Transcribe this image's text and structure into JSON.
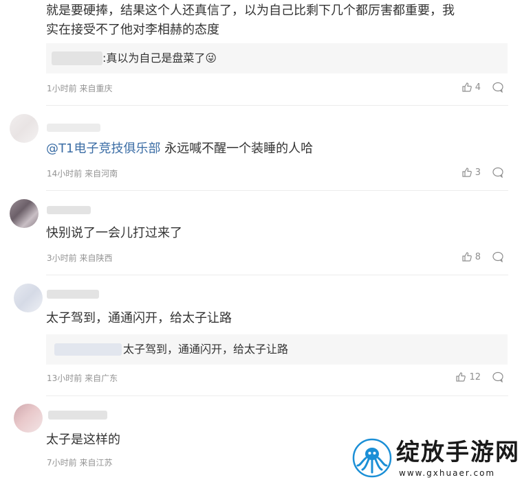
{
  "comments": [
    {
      "text_lines": [
        "就是要硬捧，结果这个人还真信了，以为自己比剩下几个都厉害都重要，我",
        "实在接受不了他对李相赫的态度"
      ],
      "reply": ":真以为自己是盘菜了😜",
      "meta": "1小时前 来自重庆",
      "likes": "4"
    },
    {
      "mention": "@T1电子竞技俱乐部",
      "text": " 永远喊不醒一个装睡的人哈",
      "meta": "14小时前 来自河南",
      "likes": "3"
    },
    {
      "text": "快别说了一会儿打过来了",
      "meta": "3小时前 来自陕西",
      "likes": "8"
    },
    {
      "text": "太子驾到，通通闪开，给太子让路",
      "reply": "太子驾到，通通闪开，给太子让路",
      "meta": "13小时前 来自广东",
      "likes": "12"
    },
    {
      "text": "太子是这样的",
      "meta": "7小时前 来自江苏"
    }
  ],
  "watermark": {
    "brand": "绽放手游网",
    "url": "www.gxhuaer.com"
  },
  "icons": {
    "like": "thumbs-up-icon",
    "comment": "comment-bubble-icon",
    "logo": "octopus-logo-icon"
  },
  "colors": {
    "mention": "#3b6da5",
    "meta": "#939393",
    "watermark_blue": "#1b8fd6"
  }
}
